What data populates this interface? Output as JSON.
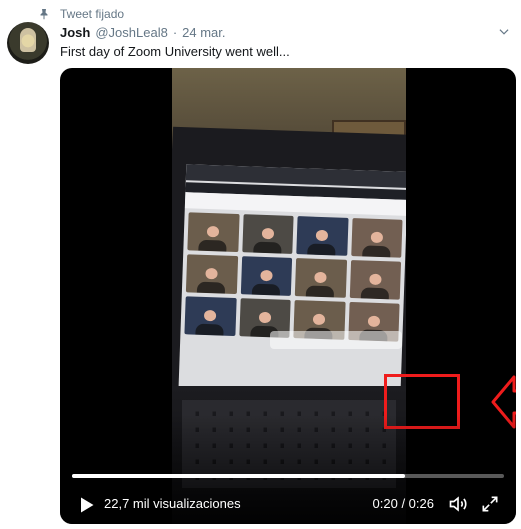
{
  "pinned_label": "Tweet fijado",
  "author": {
    "name": "Josh",
    "handle": "@JoshLeal8",
    "separator": "·",
    "date": "24 mar."
  },
  "tweet_text": "First day of Zoom University went well...",
  "video": {
    "progress": 0.77,
    "views": "22,7 mil visualizaciones",
    "time": "0:20 / 0:26"
  },
  "icons": [
    "pin-icon",
    "chevron-down-icon",
    "play-icon",
    "volume-icon",
    "fullscreen-icon"
  ],
  "colors": {
    "highlight": "#ef1c1c",
    "muted_text": "#657786",
    "media_bg": "#000000"
  }
}
